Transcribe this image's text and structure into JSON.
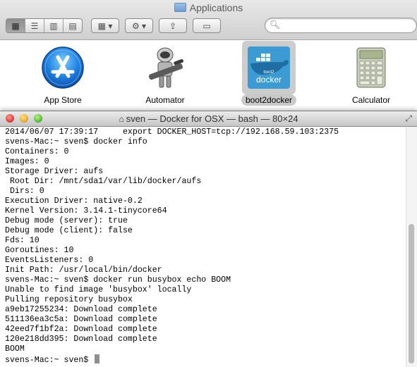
{
  "finder": {
    "title": "Applications",
    "toolbar": {
      "view_icons": "▦",
      "view_list": "☰",
      "view_columns": "▥",
      "view_coverflow": "▤",
      "arrange": "▦ ▾",
      "action": "⚙ ▾",
      "share": "⇪",
      "tags": "▭"
    },
    "search": {
      "value": "",
      "placeholder": ""
    },
    "apps": [
      {
        "label": "App Store"
      },
      {
        "label": "Automator"
      },
      {
        "label": "boot2docker",
        "selected": true
      },
      {
        "label": "Calculator"
      }
    ]
  },
  "terminal": {
    "title": "sven — Docker for OSX — bash — 80×24",
    "lines": [
      "2014/06/07 17:39:17     export DOCKER_HOST=tcp://192.168.59.103:2375",
      "svens-Mac:~ sven$ docker info",
      "Containers: 0",
      "Images: 0",
      "Storage Driver: aufs",
      " Root Dir: /mnt/sda1/var/lib/docker/aufs",
      " Dirs: 0",
      "Execution Driver: native-0.2",
      "Kernel Version: 3.14.1-tinycore64",
      "Debug mode (server): true",
      "Debug mode (client): false",
      "Fds: 10",
      "Goroutines: 10",
      "EventsListeners: 0",
      "Init Path: /usr/local/bin/docker",
      "svens-Mac:~ sven$ docker run busybox echo BOOM",
      "Unable to find image 'busybox' locally",
      "Pulling repository busybox",
      "a9eb17255234: Download complete",
      "511136ea3c5a: Download complete",
      "42eed7f1bf2a: Download complete",
      "120e218dd395: Download complete",
      "BOOM"
    ],
    "prompt": "svens-Mac:~ sven$ "
  }
}
